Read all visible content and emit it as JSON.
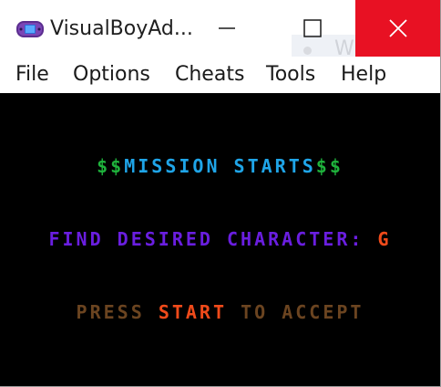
{
  "window": {
    "title": "VisualBoyAd...",
    "background_window_title": "Window Sc"
  },
  "menu": {
    "items": [
      "File",
      "Options",
      "Cheats",
      "Tools",
      "Help"
    ]
  },
  "game_screen": {
    "line1": {
      "prefix": "$$",
      "text": "MISSION STARTS",
      "suffix": "$$"
    },
    "line2": {
      "label": "FIND DESIRED CHARACTER:",
      "value": "G"
    },
    "line3": {
      "before": "PRESS",
      "highlight": "START",
      "after": "TO ACCEPT"
    }
  },
  "colors": {
    "dollar_green": "#1fb33c",
    "mission_blue": "#1fa5e8",
    "find_purple": "#6a1ee0",
    "value_orange": "#f04a1a",
    "press_brown": "#6b4420",
    "start_orange": "#f04a1a",
    "close_red": "#e81123"
  },
  "icons": {
    "app": "gameboy-advance-icon",
    "minimize": "minimize-icon",
    "maximize": "maximize-icon",
    "close": "close-icon"
  }
}
